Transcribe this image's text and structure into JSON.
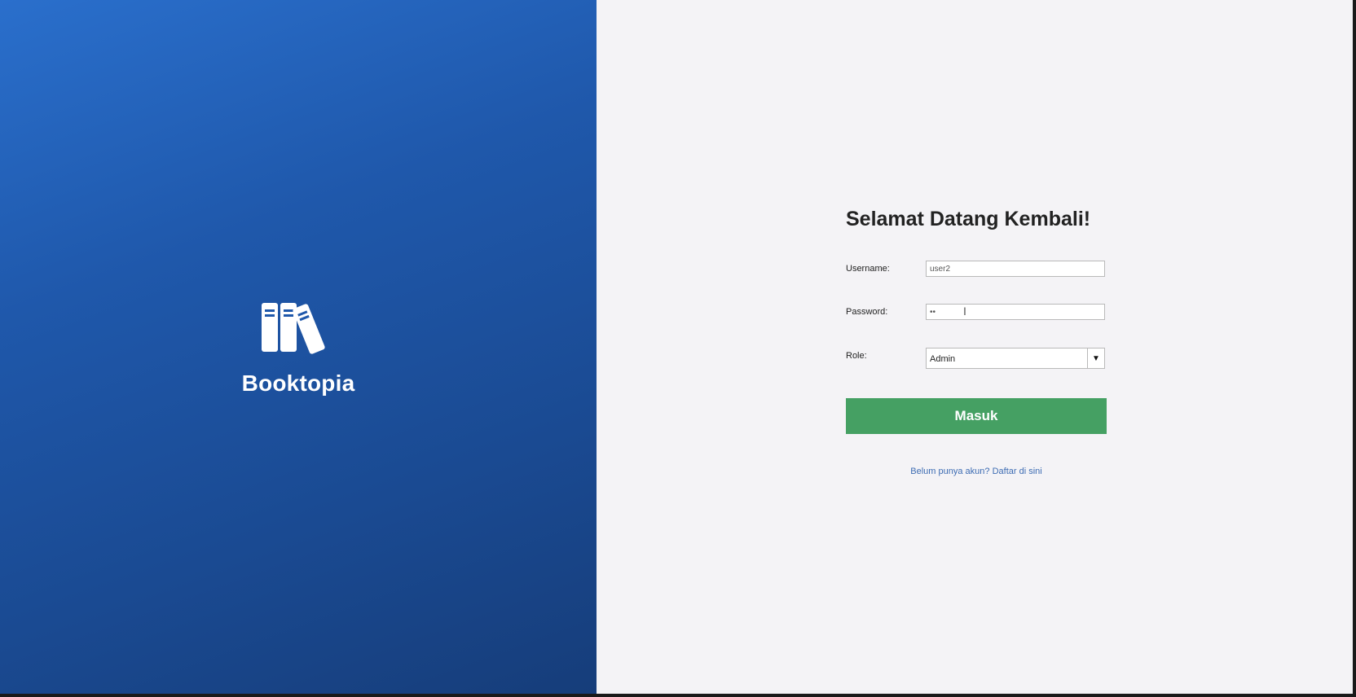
{
  "brand": {
    "name": "Booktopia",
    "logo_icon": "books-icon",
    "background_colors": [
      "#2a6fcc",
      "#163d7a"
    ]
  },
  "login": {
    "title": "Selamat Datang Kembali!",
    "username": {
      "label": "Username:",
      "value": "user2"
    },
    "password": {
      "label": "Password:",
      "value": "••"
    },
    "role": {
      "label": "Role:",
      "selected": "Admin",
      "arrow_icon": "dropdown-arrow-icon"
    },
    "submit_label": "Masuk",
    "register_link": "Belum punya akun? Daftar di sini"
  },
  "colors": {
    "accent_green": "#45a063",
    "link_blue": "#3d6cb3",
    "panel_background": "#f4f3f6"
  }
}
